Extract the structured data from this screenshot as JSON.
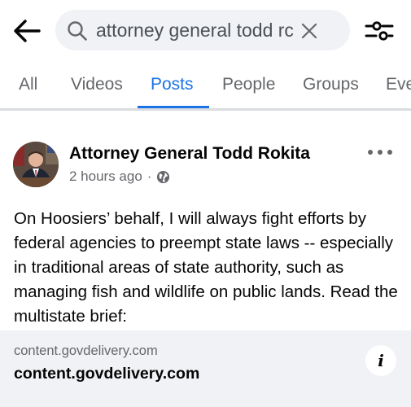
{
  "search": {
    "query": "attorney general todd rc",
    "full_query": "attorney general todd rokita"
  },
  "tabs": [
    {
      "label": "All",
      "active": false
    },
    {
      "label": "Videos",
      "active": false
    },
    {
      "label": "Posts",
      "active": true
    },
    {
      "label": "People",
      "active": false
    },
    {
      "label": "Groups",
      "active": false
    },
    {
      "label": "Eve",
      "active": false
    }
  ],
  "post": {
    "author": "Attorney General Todd Rokita",
    "time": "2 hours ago",
    "separator": "·",
    "privacy_icon": "globe-icon",
    "text": "On Hoosiers’ behalf, I will always fight efforts by federal agencies to preempt state laws -- especially in traditional areas of state authority, such as managing fish and wildlife on public lands. Read the multistate brief:",
    "link": {
      "domain_small": "content.govdelivery.com",
      "domain_large": "content.govdelivery.com"
    }
  },
  "colors": {
    "accent": "#1b74e4",
    "muted_text": "#65676b",
    "search_bg": "#f0f2f5"
  }
}
